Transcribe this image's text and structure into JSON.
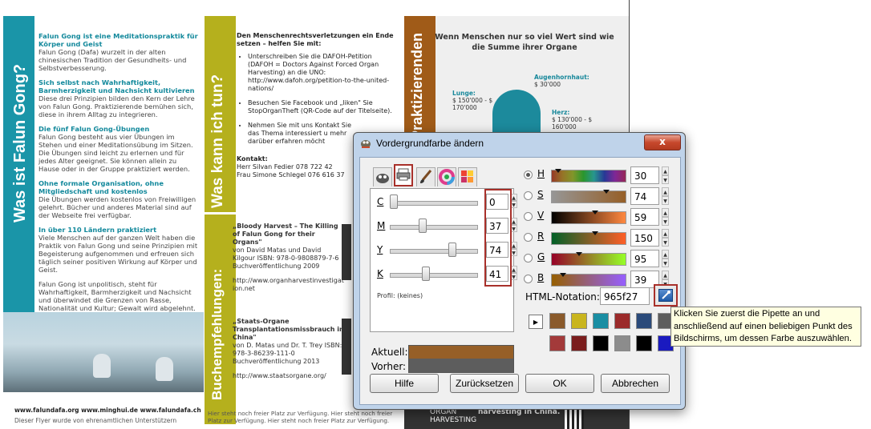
{
  "flyer": {
    "panel1": {
      "vertical_title": "Was ist Falun Gong?",
      "blocks": [
        {
          "heading": "Falun Gong ist eine Meditationspraktik für Körper und Geist",
          "text": "Falun Gong (Dafa) wurzelt in der alten chinesischen Tradition der Gesundheits- und Selbstverbesserung."
        },
        {
          "heading": "Sich selbst nach Wahrhaftigkeit, Barmherzigkeit und Nachsicht kultivieren",
          "text": "Diese drei Prinzipien bilden den Kern der Lehre von Falun Gong. Praktizierende bemühen sich, diese in ihrem Alltag zu integrieren."
        },
        {
          "heading": "Die fünf Falun Gong-Übungen",
          "text": "Falun Gong besteht aus vier Übungen im Stehen und einer Meditationsübung im Sitzen. Die Übungen sind leicht zu erlernen und für jedes Alter geeignet. Sie können allein zu Hause oder in der Gruppe praktiziert werden."
        },
        {
          "heading": "Ohne formale Organisation, ohne Mitgliedschaft und kostenlos",
          "text": "Die Übungen werden kostenlos von Freiwilligen gelehrt. Bücher und anderes Material sind auf der Webseite frei verfügbar."
        },
        {
          "heading": "In über 110 Ländern praktiziert",
          "text": "Viele Menschen auf der ganzen Welt haben die Praktik von Falun Gong und seine Prinzipien mit Begeisterung aufgenommen und erfreuen sich täglich seiner positiven Wirkung auf Körper und Geist."
        },
        {
          "heading": "",
          "text": "Falun Gong ist unpolitisch, steht für Wahrhaftigkeit, Barmherzigkeit und Nachsicht und überwindet die Grenzen von Rasse, Nationalität und Kultur; Gewalt wird abgelehnt."
        }
      ],
      "footer_links": "www.falundafa.org www.minghui.de www.falundafa.ch",
      "footer_note": "Dieser Flyer wurde von ehrenamtlichen Unterstützern"
    },
    "panel2": {
      "vertical_title_top": "Was kann ich tun?",
      "vertical_title_bottom": "Buchempfehlungen:",
      "intro": "Den Menschenrechtsverletzungen ein Ende setzen – helfen Sie mit:",
      "bullets": [
        "Unterschreiben Sie die DAFOH-Petition (DAFOH = Doctors Against Forced Organ Harvesting) an die UNO: http://www.dafoh.org/petition-to-the-united-nations/",
        "Besuchen Sie Facebook und „liken\" Sie StopOrganTheft (QR-Code auf der Titelseite).",
        "Nehmen Sie mit uns Kontakt Sie das Thema interessiert u mehr darüber erfahren möcht"
      ],
      "contact_label": "Kontakt:",
      "contacts": [
        "Herr Silvan Fedier 078 722 42",
        "Frau Simone Schlegel 076 616 37"
      ],
      "book1": {
        "title": "„Bloody Harvest – The Killing of Falun Gong for their Organs\"",
        "rest": "von David Matas und David Kilgour ISBN: 978-0-9808879-7-6 Buchveröffentlichung 2009",
        "url": "http://www.organharvestinvestigation.net"
      },
      "book2": {
        "title": "„Staats-Organe Transplantationsmissbrauch in China\"",
        "rest": "von D. Matas und Dr. T. Trey ISBN: 978-3-86239-111-0 Buchveröffentlichung 2013",
        "url": "http://www.staatsorgane.org/"
      },
      "footer": "Hier steht noch freier Platz zur Verfügung. Hier steht noch freier Platz zur Verfügung. Hier steht noch freier Platz zur Verfügung."
    },
    "panel3": {
      "vertical_title": "Praktizierenden",
      "title": "Wenn Menschen nur so viel Wert sind wie die Summe ihrer Organe",
      "organs": [
        {
          "name": "Augenhornhaut:",
          "value": "$ 30'000"
        },
        {
          "name": "Lunge:",
          "value": "$ 150'000 - $ 170'000"
        },
        {
          "name": "Herz:",
          "value": "$ 130'000 - $ 160'000"
        }
      ],
      "footer_brand": "ORGAN HARVESTING",
      "footer_tag": "harvesting in China."
    }
  },
  "dialog": {
    "title": "Vordergrundfarbe ändern",
    "close_label": "x",
    "tabs": [
      "gimp-tab",
      "cmyk-tab",
      "watercolor-tab",
      "wheel-tab",
      "palette-tab"
    ],
    "cmyk": [
      {
        "label": "C",
        "value": "0",
        "fraction": 0.0
      },
      {
        "label": "M",
        "value": "37",
        "fraction": 0.37
      },
      {
        "label": "Y",
        "value": "74",
        "fraction": 0.74
      },
      {
        "label": "K",
        "value": "41",
        "fraction": 0.41
      }
    ],
    "profile": "Profil: (keines)",
    "aktuell_label": "Aktuell:",
    "vorher_label": "Vorher:",
    "current_color": "#965f27",
    "previous_color": "#5d5d5d",
    "channels": [
      {
        "label": "H",
        "value": "30",
        "max": 360,
        "selected": true
      },
      {
        "label": "S",
        "value": "74",
        "max": 100,
        "selected": false
      },
      {
        "label": "V",
        "value": "59",
        "max": 100,
        "selected": false
      },
      {
        "label": "R",
        "value": "150",
        "max": 255,
        "selected": false
      },
      {
        "label": "G",
        "value": "95",
        "max": 255,
        "selected": false
      },
      {
        "label": "B",
        "value": "39",
        "max": 255,
        "selected": false
      }
    ],
    "html_label": "HTML-Notation:",
    "html_value": "965f27",
    "history": [
      [
        "#8a5a2b",
        "#c9b51e",
        "#1a8ea3",
        "#9b2a2a",
        "#2a4a7a",
        "#5d5d5d"
      ],
      [
        "#a33a3a",
        "#7a1d1d",
        "#000000",
        "#8c8c8c",
        "#000000",
        "#1a1ac0"
      ]
    ],
    "buttons": {
      "help": "Hilfe",
      "reset": "Zurücksetzen",
      "ok": "OK",
      "cancel": "Abbrechen"
    }
  },
  "tooltip": "Klicken Sie zuerst die Pipette an und anschließend auf einen beliebigen Punkt des Bildschirms, um dessen Farbe auszuwählen."
}
